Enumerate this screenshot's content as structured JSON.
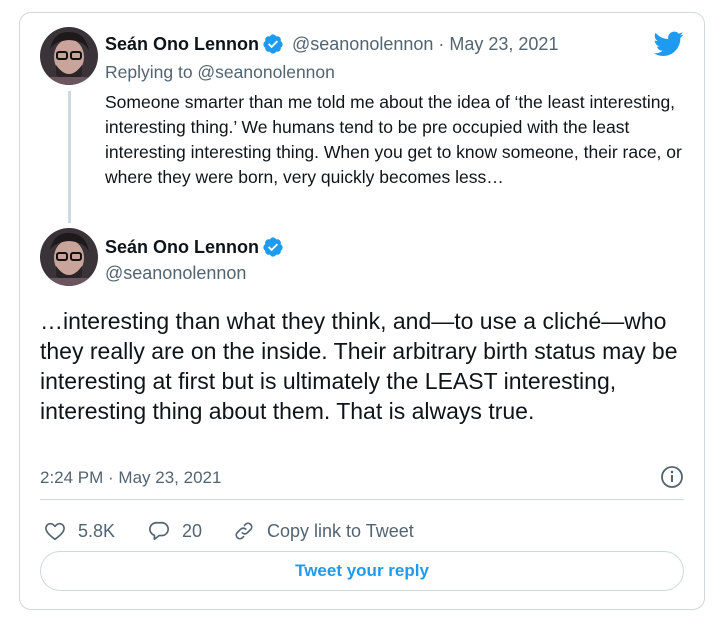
{
  "colors": {
    "accent": "#1d9bf0",
    "muted": "#536471",
    "text": "#0f1419",
    "border": "#cfd9de"
  },
  "parent": {
    "author_name": "Seán Ono Lennon",
    "handle_and_date": "@seanonolennon · May 23, 2021",
    "replying_to": "Replying to @seanonolennon",
    "text": "Someone smarter than me told me about the idea of ‘the least interesting, interesting thing.’ We humans tend to be pre occupied with the least interesting interesting thing. When you get to know someone, their race, or where they were born, very quickly becomes less…"
  },
  "main": {
    "author_name": "Seán Ono Lennon",
    "handle": "@seanonolennon",
    "text": "…interesting than what they think, and—to use a cliché—who they really are on the inside. Their arbitrary birth status may be interesting at first but is ultimately the LEAST interesting, interesting thing about them. That is always true.",
    "timestamp": "2:24 PM · May 23, 2021"
  },
  "actions": {
    "likes": "5.8K",
    "replies": "20",
    "copy_link": "Copy link to Tweet"
  },
  "reply_button": "Tweet your reply",
  "icons": [
    "twitter-bird-icon",
    "verified-badge-icon",
    "info-icon",
    "heart-icon",
    "reply-bubble-icon",
    "link-icon"
  ]
}
